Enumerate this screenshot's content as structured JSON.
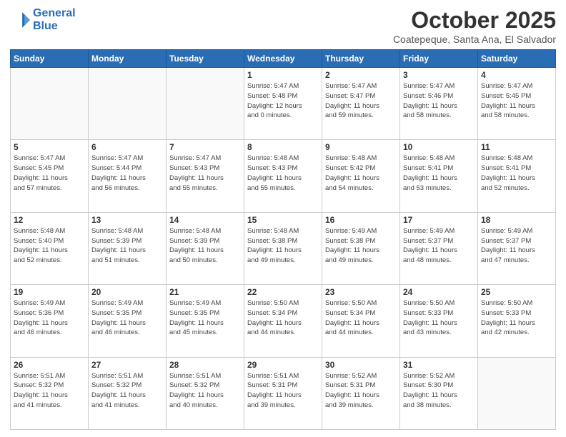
{
  "header": {
    "logo_line1": "General",
    "logo_line2": "Blue",
    "month": "October 2025",
    "location": "Coatepeque, Santa Ana, El Salvador"
  },
  "days_of_week": [
    "Sunday",
    "Monday",
    "Tuesday",
    "Wednesday",
    "Thursday",
    "Friday",
    "Saturday"
  ],
  "weeks": [
    [
      {
        "day": "",
        "info": ""
      },
      {
        "day": "",
        "info": ""
      },
      {
        "day": "",
        "info": ""
      },
      {
        "day": "1",
        "info": "Sunrise: 5:47 AM\nSunset: 5:48 PM\nDaylight: 12 hours\nand 0 minutes."
      },
      {
        "day": "2",
        "info": "Sunrise: 5:47 AM\nSunset: 5:47 PM\nDaylight: 11 hours\nand 59 minutes."
      },
      {
        "day": "3",
        "info": "Sunrise: 5:47 AM\nSunset: 5:46 PM\nDaylight: 11 hours\nand 58 minutes."
      },
      {
        "day": "4",
        "info": "Sunrise: 5:47 AM\nSunset: 5:45 PM\nDaylight: 11 hours\nand 58 minutes."
      }
    ],
    [
      {
        "day": "5",
        "info": "Sunrise: 5:47 AM\nSunset: 5:45 PM\nDaylight: 11 hours\nand 57 minutes."
      },
      {
        "day": "6",
        "info": "Sunrise: 5:47 AM\nSunset: 5:44 PM\nDaylight: 11 hours\nand 56 minutes."
      },
      {
        "day": "7",
        "info": "Sunrise: 5:47 AM\nSunset: 5:43 PM\nDaylight: 11 hours\nand 55 minutes."
      },
      {
        "day": "8",
        "info": "Sunrise: 5:48 AM\nSunset: 5:43 PM\nDaylight: 11 hours\nand 55 minutes."
      },
      {
        "day": "9",
        "info": "Sunrise: 5:48 AM\nSunset: 5:42 PM\nDaylight: 11 hours\nand 54 minutes."
      },
      {
        "day": "10",
        "info": "Sunrise: 5:48 AM\nSunset: 5:41 PM\nDaylight: 11 hours\nand 53 minutes."
      },
      {
        "day": "11",
        "info": "Sunrise: 5:48 AM\nSunset: 5:41 PM\nDaylight: 11 hours\nand 52 minutes."
      }
    ],
    [
      {
        "day": "12",
        "info": "Sunrise: 5:48 AM\nSunset: 5:40 PM\nDaylight: 11 hours\nand 52 minutes."
      },
      {
        "day": "13",
        "info": "Sunrise: 5:48 AM\nSunset: 5:39 PM\nDaylight: 11 hours\nand 51 minutes."
      },
      {
        "day": "14",
        "info": "Sunrise: 5:48 AM\nSunset: 5:39 PM\nDaylight: 11 hours\nand 50 minutes."
      },
      {
        "day": "15",
        "info": "Sunrise: 5:48 AM\nSunset: 5:38 PM\nDaylight: 11 hours\nand 49 minutes."
      },
      {
        "day": "16",
        "info": "Sunrise: 5:49 AM\nSunset: 5:38 PM\nDaylight: 11 hours\nand 49 minutes."
      },
      {
        "day": "17",
        "info": "Sunrise: 5:49 AM\nSunset: 5:37 PM\nDaylight: 11 hours\nand 48 minutes."
      },
      {
        "day": "18",
        "info": "Sunrise: 5:49 AM\nSunset: 5:37 PM\nDaylight: 11 hours\nand 47 minutes."
      }
    ],
    [
      {
        "day": "19",
        "info": "Sunrise: 5:49 AM\nSunset: 5:36 PM\nDaylight: 11 hours\nand 46 minutes."
      },
      {
        "day": "20",
        "info": "Sunrise: 5:49 AM\nSunset: 5:35 PM\nDaylight: 11 hours\nand 46 minutes."
      },
      {
        "day": "21",
        "info": "Sunrise: 5:49 AM\nSunset: 5:35 PM\nDaylight: 11 hours\nand 45 minutes."
      },
      {
        "day": "22",
        "info": "Sunrise: 5:50 AM\nSunset: 5:34 PM\nDaylight: 11 hours\nand 44 minutes."
      },
      {
        "day": "23",
        "info": "Sunrise: 5:50 AM\nSunset: 5:34 PM\nDaylight: 11 hours\nand 44 minutes."
      },
      {
        "day": "24",
        "info": "Sunrise: 5:50 AM\nSunset: 5:33 PM\nDaylight: 11 hours\nand 43 minutes."
      },
      {
        "day": "25",
        "info": "Sunrise: 5:50 AM\nSunset: 5:33 PM\nDaylight: 11 hours\nand 42 minutes."
      }
    ],
    [
      {
        "day": "26",
        "info": "Sunrise: 5:51 AM\nSunset: 5:32 PM\nDaylight: 11 hours\nand 41 minutes."
      },
      {
        "day": "27",
        "info": "Sunrise: 5:51 AM\nSunset: 5:32 PM\nDaylight: 11 hours\nand 41 minutes."
      },
      {
        "day": "28",
        "info": "Sunrise: 5:51 AM\nSunset: 5:32 PM\nDaylight: 11 hours\nand 40 minutes."
      },
      {
        "day": "29",
        "info": "Sunrise: 5:51 AM\nSunset: 5:31 PM\nDaylight: 11 hours\nand 39 minutes."
      },
      {
        "day": "30",
        "info": "Sunrise: 5:52 AM\nSunset: 5:31 PM\nDaylight: 11 hours\nand 39 minutes."
      },
      {
        "day": "31",
        "info": "Sunrise: 5:52 AM\nSunset: 5:30 PM\nDaylight: 11 hours\nand 38 minutes."
      },
      {
        "day": "",
        "info": ""
      }
    ]
  ]
}
